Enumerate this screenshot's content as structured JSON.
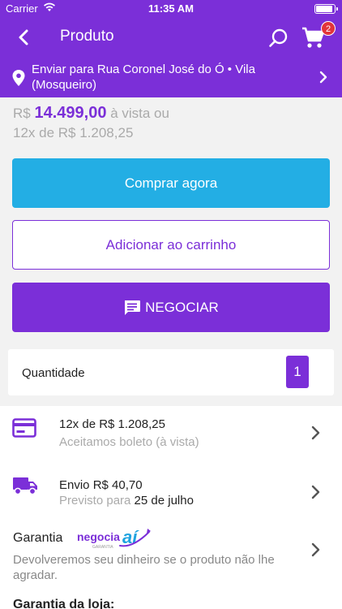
{
  "status_bar": {
    "carrier": "Carrier",
    "time": "11:35 AM"
  },
  "nav": {
    "title": "Produto",
    "cart_count": "2"
  },
  "address": {
    "text": "Enviar para Rua Coronel José do Ó • Vila (Mosqueiro)"
  },
  "price": {
    "currency": "R$",
    "amount": "14.499,00",
    "suffix": "à vista ou",
    "installment": "12x de R$ 1.208,25"
  },
  "buttons": {
    "buy_now": "Comprar agora",
    "add_to_cart": "Adicionar ao carrinho",
    "negotiate": "NEGOCIAR"
  },
  "quantity": {
    "label": "Quantidade",
    "value": "1"
  },
  "payment": {
    "title": "12x de R$ 1.208,25",
    "subtitle": "Aceitamos boleto (à vista)"
  },
  "shipping": {
    "title": "Envio R$ 40,70",
    "subtitle_prefix": "Previsto para",
    "date": "25 de julho"
  },
  "guarantee": {
    "title": "Garantia",
    "logo_text": "negocia",
    "logo_text_2": "aí",
    "logo_subtext": "GARANTIA",
    "description": "Devolveremos seu dinheiro se o produto não lhe agradar."
  },
  "store_guarantee": {
    "title": "Garantia da loja:"
  },
  "colors": {
    "brand": "#7b2fd8",
    "buy_button": "#23aee4",
    "badge": "#e2343a",
    "logo_blue": "#1fa3e0"
  }
}
